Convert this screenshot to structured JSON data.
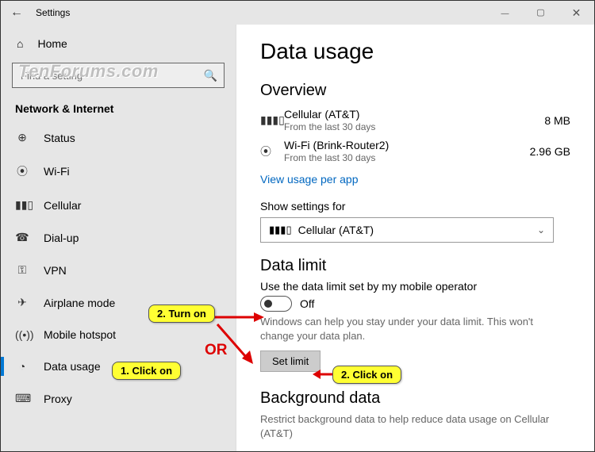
{
  "window": {
    "title": "Settings"
  },
  "sidebar": {
    "home": "Home",
    "search_placeholder": "Find a setting",
    "group": "Network & Internet",
    "items": [
      {
        "icon": "⊕",
        "label": "Status"
      },
      {
        "icon": "⦿",
        "label": "Wi-Fi"
      },
      {
        "icon": "▮▮▯",
        "label": "Cellular"
      },
      {
        "icon": "☎",
        "label": "Dial-up"
      },
      {
        "icon": "⚿",
        "label": "VPN"
      },
      {
        "icon": "✈",
        "label": "Airplane mode"
      },
      {
        "icon": "((•))",
        "label": "Mobile hotspot"
      },
      {
        "icon": "◔",
        "label": "Data usage"
      },
      {
        "icon": "⌨",
        "label": "Proxy"
      }
    ]
  },
  "page": {
    "title": "Data usage",
    "overview": {
      "heading": "Overview",
      "rows": [
        {
          "icon": "▮▮▮▯",
          "name": "Cellular (AT&T)",
          "sub": "From the last 30 days",
          "value": "8 MB"
        },
        {
          "icon": "⦿",
          "name": "Wi-Fi (Brink-Router2)",
          "sub": "From the last 30 days",
          "value": "2.96 GB"
        }
      ],
      "link": "View usage per app"
    },
    "show_for": {
      "label": "Show settings for",
      "selected": "Cellular (AT&T)",
      "icon": "▮▮▮▯"
    },
    "data_limit": {
      "heading": "Data limit",
      "use_operator": "Use the data limit set by my mobile operator",
      "toggle_state": "Off",
      "help": "Windows can help you stay under your data limit. This won't change your data plan.",
      "set_limit_btn": "Set limit"
    },
    "background": {
      "heading": "Background data",
      "text": "Restrict background data to help reduce data usage on Cellular (AT&T)"
    }
  },
  "annotations": {
    "step1": "1. Click on",
    "step2a": "2. Turn on",
    "step2b": "2. Click on",
    "or": "OR"
  },
  "watermark": "TenForums.com"
}
